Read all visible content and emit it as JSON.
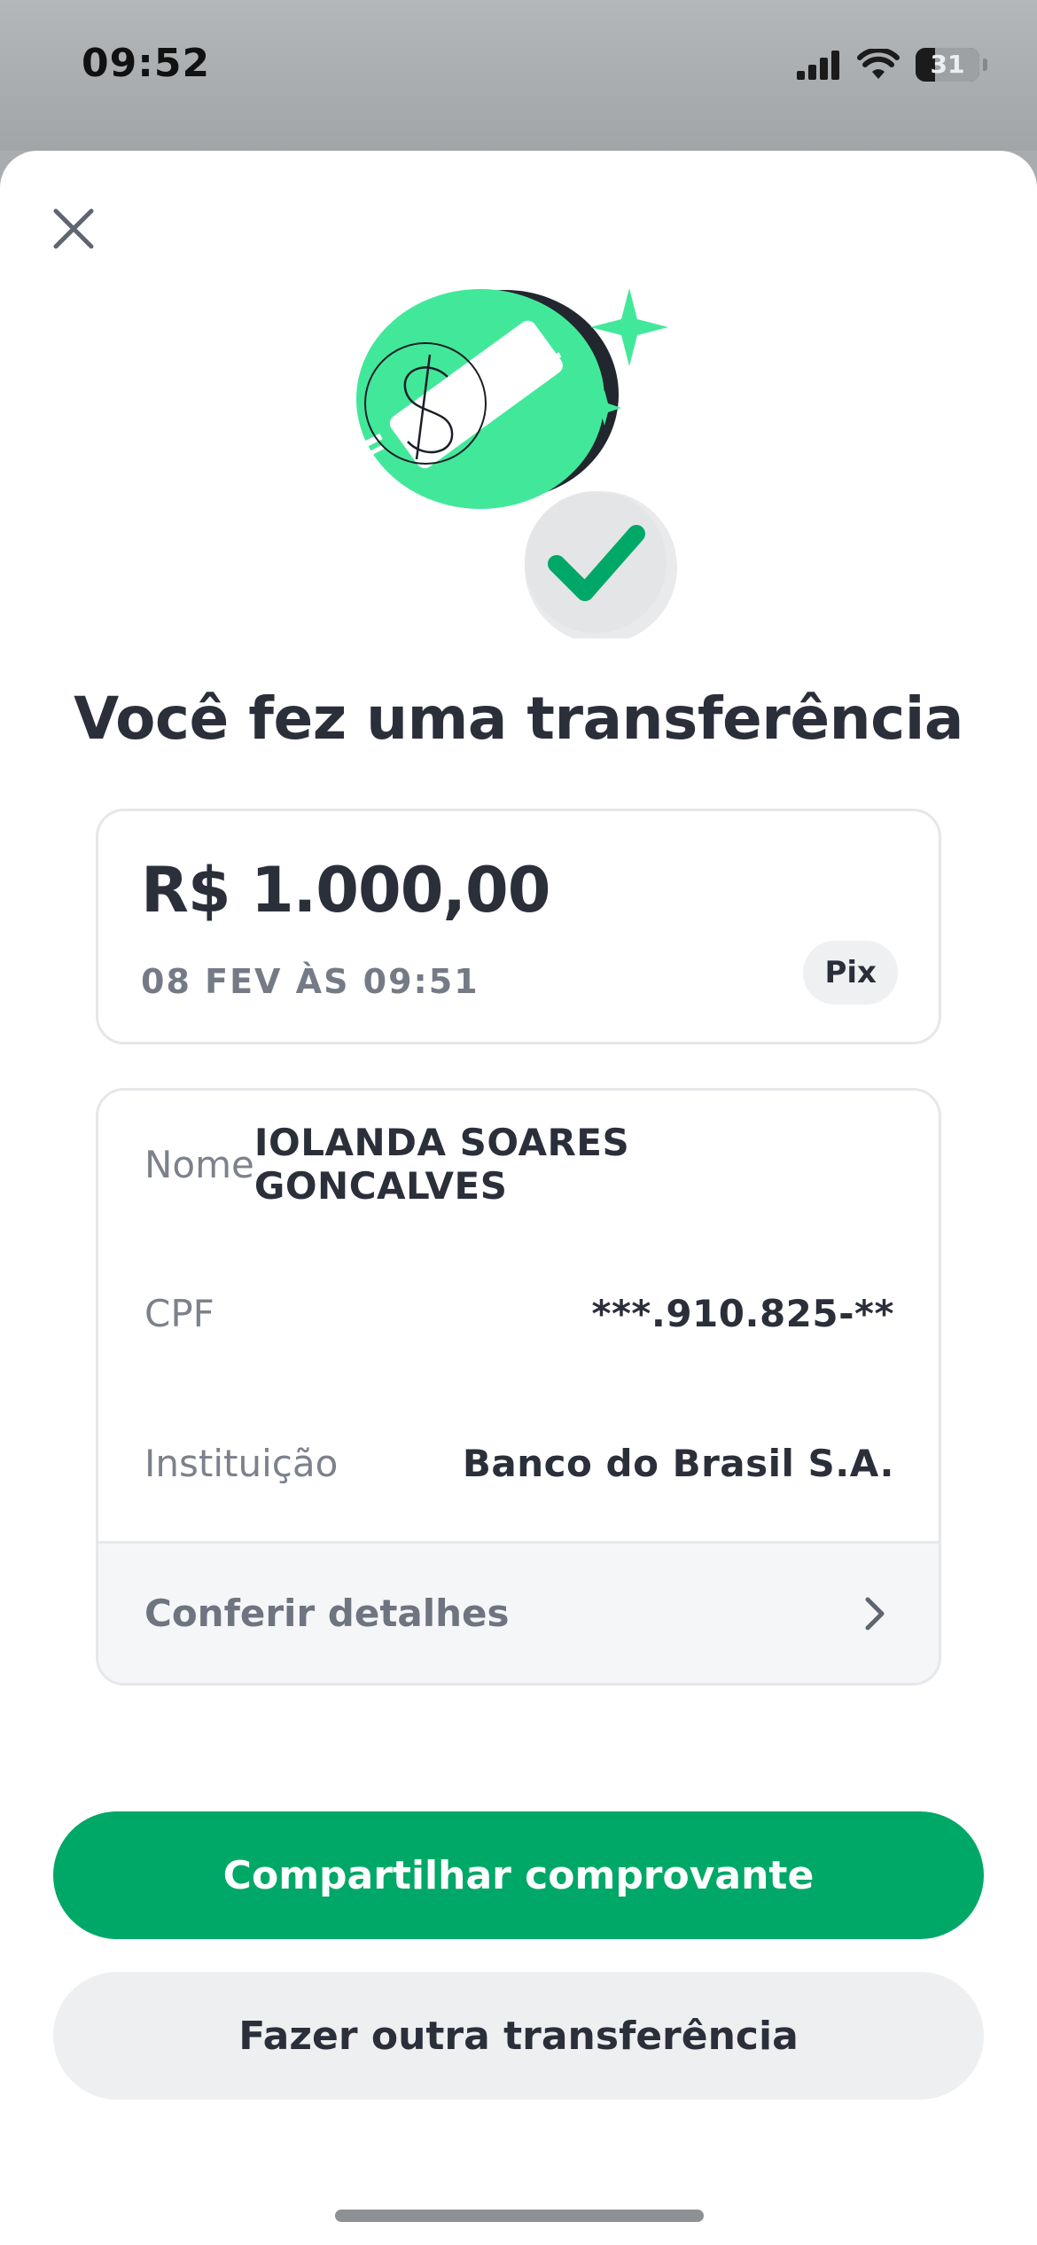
{
  "status_bar": {
    "time": "09:52",
    "battery": "31"
  },
  "sheet": {
    "title": "Você fez uma transferência",
    "amount_card": {
      "amount": "R$ 1.000,00",
      "date": "08 FEV ÀS 09:51",
      "badge": "Pix"
    },
    "details": {
      "rows": [
        {
          "label": "Nome",
          "value": "IOLANDA SOARES GONCALVES"
        },
        {
          "label": "CPF",
          "value": "***.910.825-**"
        },
        {
          "label": "Instituição",
          "value": "Banco do Brasil S.A."
        }
      ],
      "footer_label": "Conferir detalhes"
    },
    "buttons": {
      "primary": "Compartilhar comprovante",
      "secondary": "Fazer outra transferência"
    }
  },
  "icons": {
    "close": "close-icon",
    "chevron": "chevron-right-icon",
    "illustration": "money-transfer-success-illustration"
  },
  "colors": {
    "accent": "#00a868",
    "illustration_green": "#42e89a",
    "text_dark": "#2b2f3a",
    "text_muted": "#7c818b"
  }
}
